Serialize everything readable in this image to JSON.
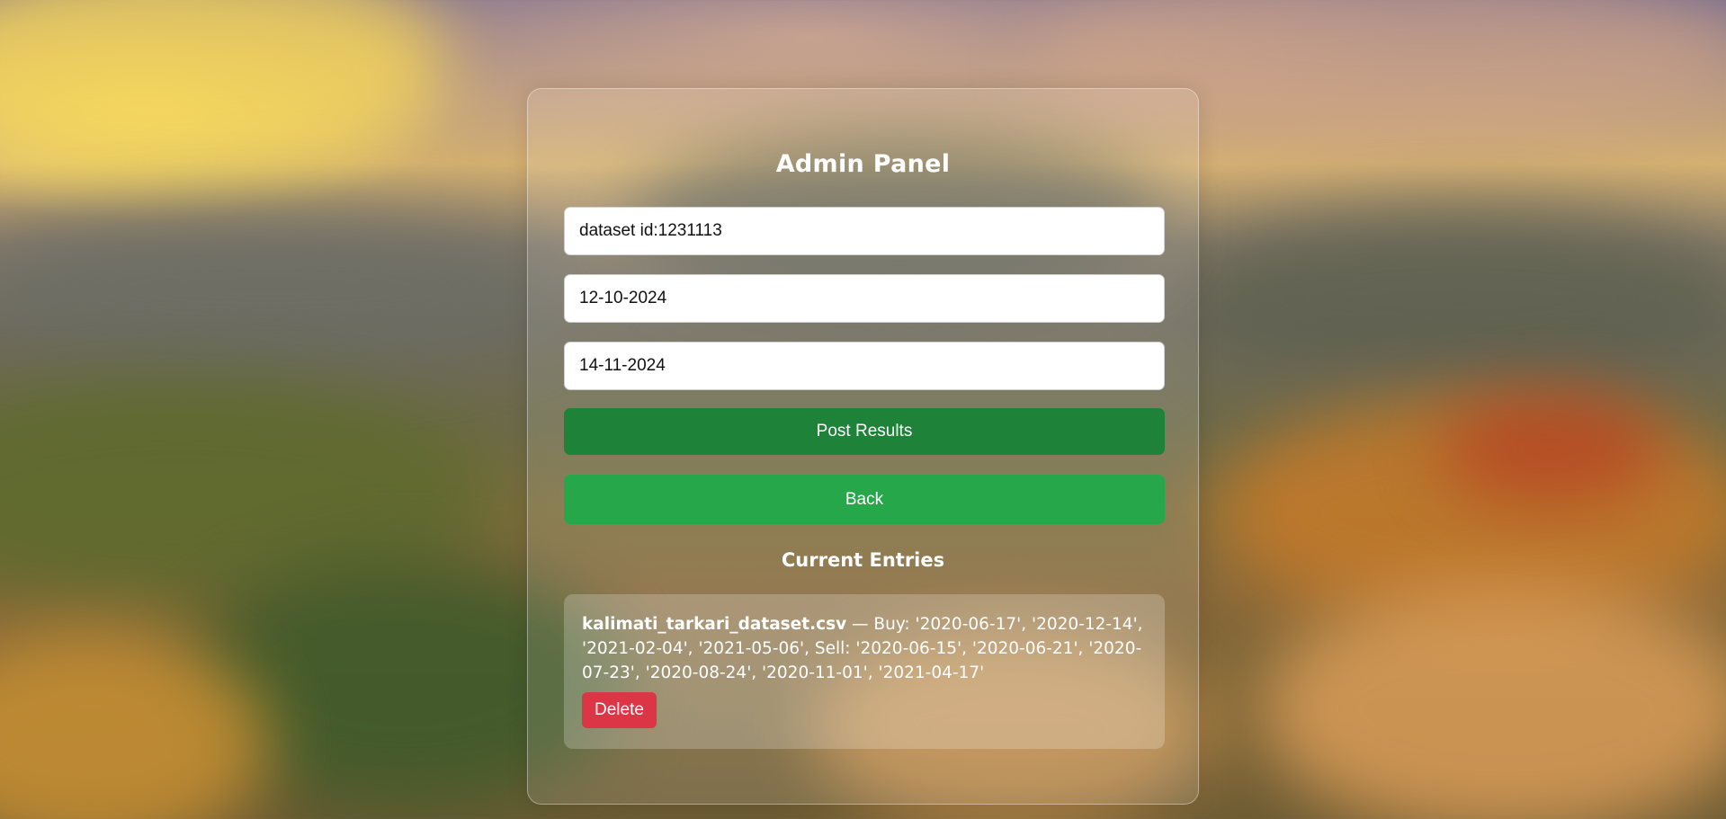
{
  "panel": {
    "title": "Admin Panel",
    "fields": {
      "dataset_id": "dataset id:1231113",
      "start_date": "12-10-2024",
      "end_date": "14-11-2024"
    },
    "post_label": "Post Results",
    "back_label": "Back",
    "entries_heading": "Current Entries",
    "entries": [
      {
        "filename": "kalimati_tarkari_dataset.csv",
        "details": " — Buy: '2020-06-17', '2020-12-14', '2021-02-04', '2021-05-06', Sell: '2020-06-15', '2020-06-21', '2020-07-23', '2020-08-24', '2020-11-01', '2021-04-17'",
        "delete_label": "Delete"
      }
    ]
  },
  "colors": {
    "post_button": "#1e8239",
    "back_button": "#26a84a",
    "delete_button": "#dc3545"
  }
}
